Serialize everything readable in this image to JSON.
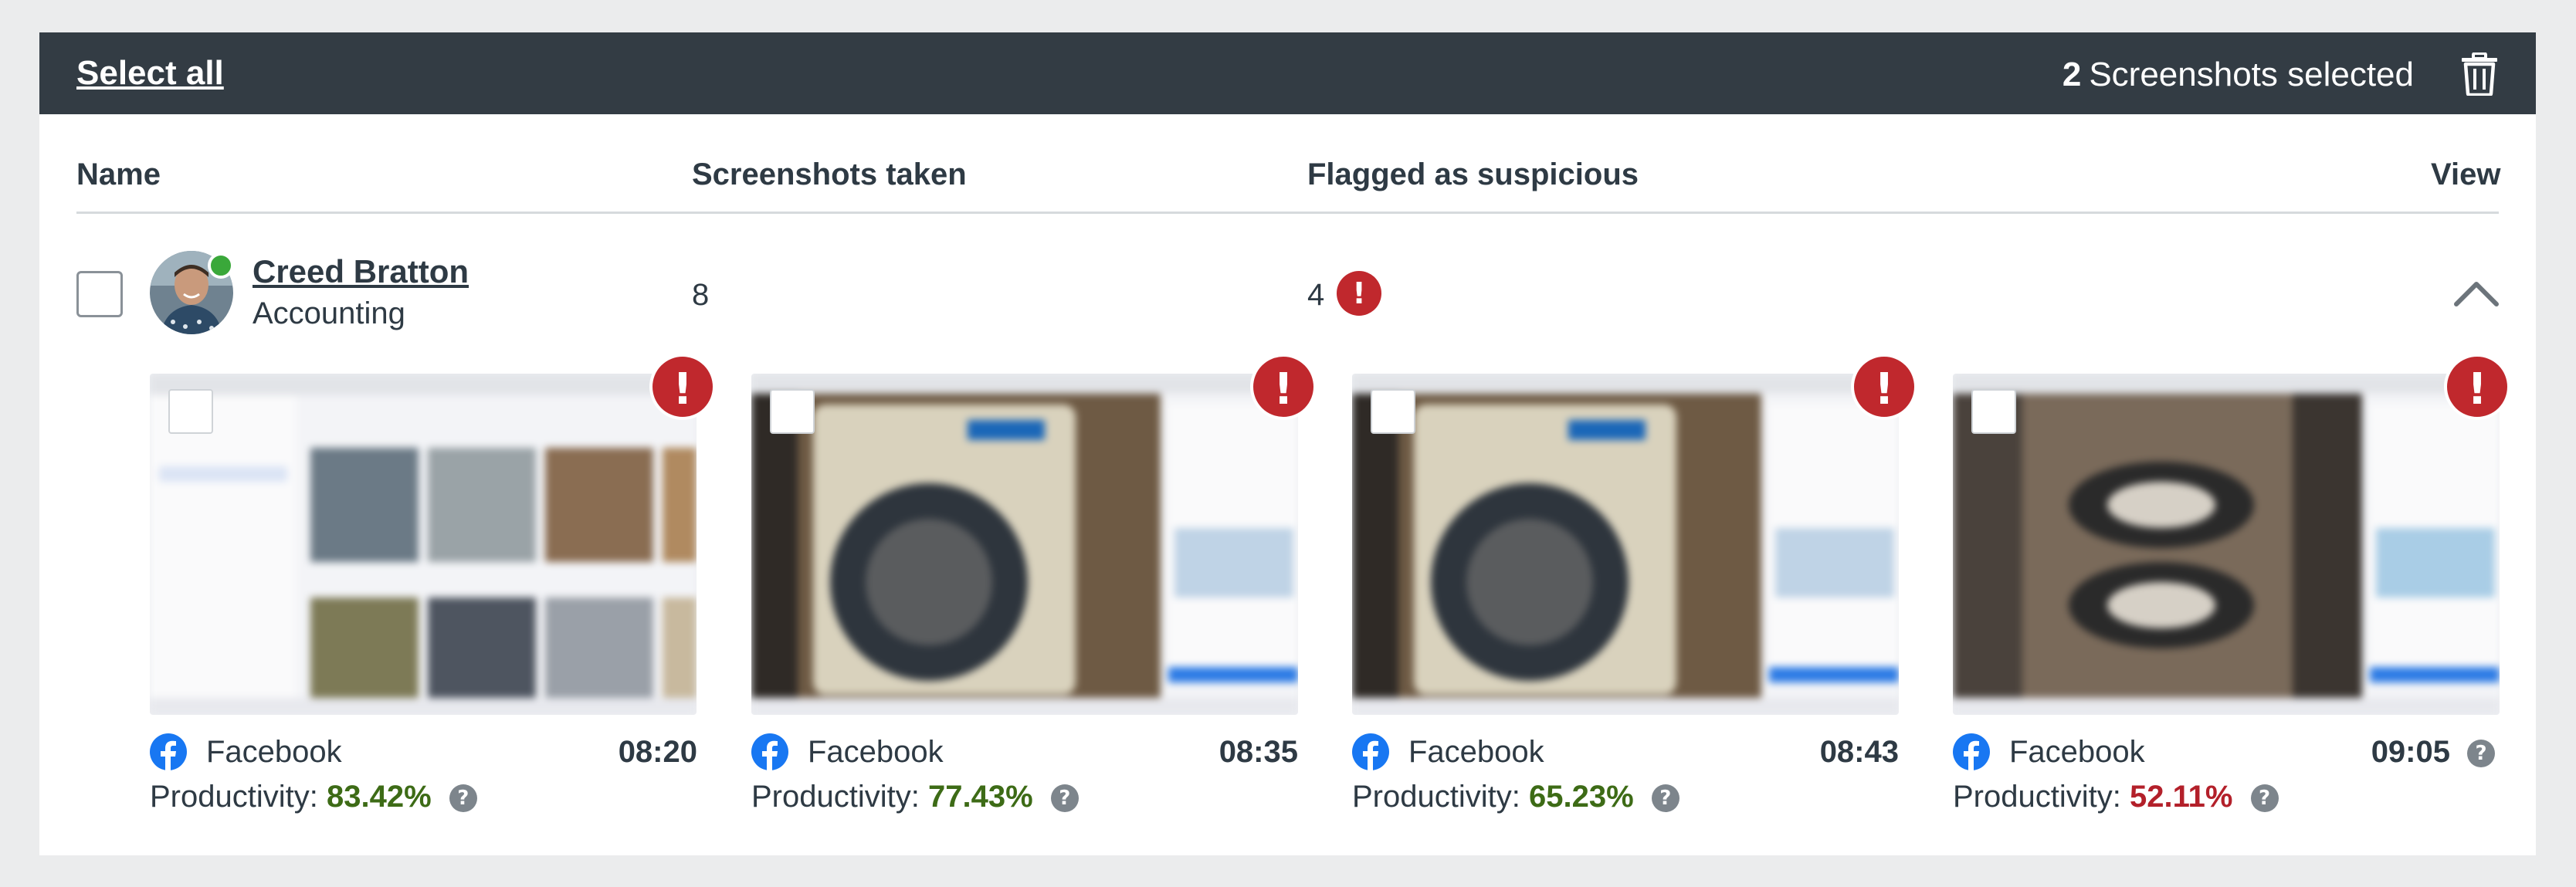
{
  "toolbar": {
    "select_all_label": "Select all",
    "selected_count": "2",
    "selected_suffix": "Screenshots selected"
  },
  "table": {
    "headers": {
      "name": "Name",
      "screenshots_taken": "Screenshots taken",
      "flagged": "Flagged as suspicious",
      "view": "View"
    },
    "row": {
      "user_name": "Creed Bratton",
      "department": "Accounting",
      "screenshots_taken": "8",
      "flagged_count": "4",
      "alert_glyph": "!"
    }
  },
  "screenshots": [
    {
      "app": "Facebook",
      "time": "08:20",
      "productivity_label": "Productivity:",
      "productivity": "83.42%",
      "status": "good",
      "flag": "!",
      "help": "?",
      "image": "marketplace-grid"
    },
    {
      "app": "Facebook",
      "time": "08:35",
      "productivity_label": "Productivity:",
      "productivity": "77.43%",
      "status": "good",
      "flag": "!",
      "help": "?",
      "image": "washing-machine"
    },
    {
      "app": "Facebook",
      "time": "08:43",
      "productivity_label": "Productivity:",
      "productivity": "65.23%",
      "status": "good",
      "flag": "!",
      "help": "?",
      "image": "washing-machine"
    },
    {
      "app": "Facebook",
      "time": "09:05",
      "productivity_label": "Productivity:",
      "productivity": "52.11%",
      "status": "bad",
      "flag": "!",
      "help": "?",
      "time_help": "?",
      "image": "shoes"
    }
  ],
  "colors": {
    "topbar": "#333c44",
    "alert": "#c0282d",
    "good": "#3d6b16",
    "bad": "#b3202a",
    "online": "#3aa83a",
    "facebook": "#1877f2"
  },
  "icons": [
    "trash-icon",
    "alert-icon",
    "chevron-up-icon",
    "facebook-icon",
    "help-icon",
    "online-status-icon"
  ]
}
